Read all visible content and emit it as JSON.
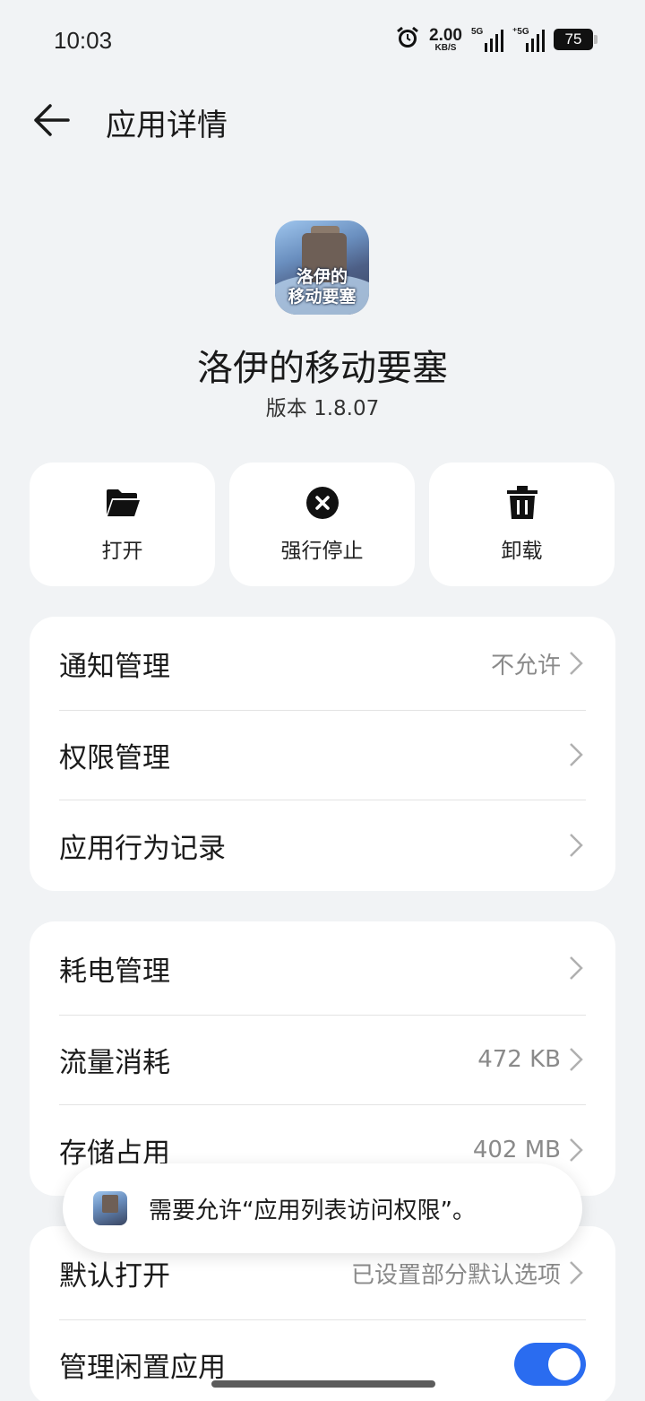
{
  "status_bar": {
    "time": "10:03",
    "net_speed_value": "2.00",
    "net_speed_unit": "KB/S",
    "sim1_label": "5G",
    "sim2_label": "⁺5G",
    "battery": "75"
  },
  "header": {
    "title": "应用详情"
  },
  "app": {
    "name": "洛伊的移动要塞",
    "version": "版本 1.8.07",
    "icon_text_line1": "洛伊的",
    "icon_text_line2": "移动要塞"
  },
  "actions": [
    {
      "label": "打开",
      "icon": "folder-icon"
    },
    {
      "label": "强行停止",
      "icon": "close-circle-icon"
    },
    {
      "label": "卸载",
      "icon": "trash-icon"
    }
  ],
  "group1": [
    {
      "label": "通知管理",
      "value": "不允许"
    },
    {
      "label": "权限管理",
      "value": ""
    },
    {
      "label": "应用行为记录",
      "value": ""
    }
  ],
  "group2": [
    {
      "label": "耗电管理",
      "value": ""
    },
    {
      "label": "流量消耗",
      "value": "472 KB"
    },
    {
      "label": "存储占用",
      "value": "402 MB"
    }
  ],
  "group3": [
    {
      "label": "默认打开",
      "value": "已设置部分默认选项"
    },
    {
      "label": "管理闲置应用",
      "toggle_on": true
    }
  ],
  "toast": {
    "message": "需要允许“应用列表访问权限”。"
  },
  "colors": {
    "background": "#f1f3f5",
    "accent": "#2a6cf0"
  }
}
